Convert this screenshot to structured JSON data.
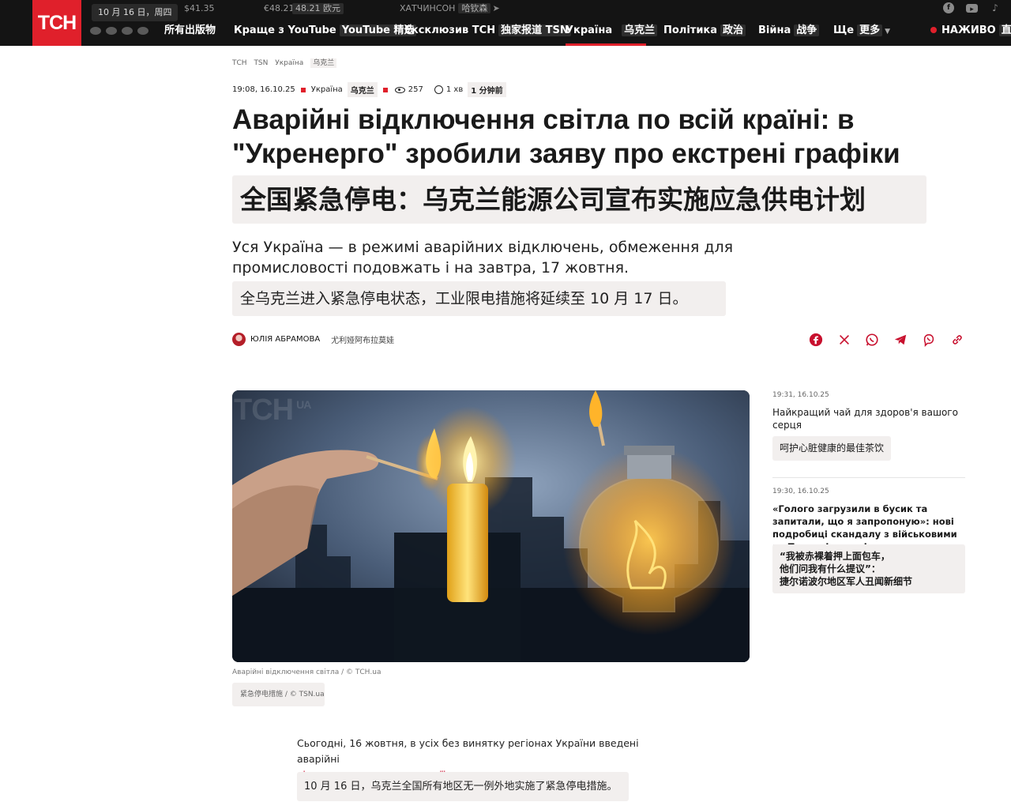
{
  "topbar": {
    "logo": "ТСН",
    "date": "10 月 16 日，周四",
    "rates": [
      "$41.35",
      "€48.21",
      "48.21 欧元"
    ],
    "weather_city": "ХАТЧИНСОН",
    "weather_city_zh": "哈钦森",
    "nav": [
      {
        "label": "所有出版物",
        "zh": ""
      },
      {
        "label": "Краще з YouTube",
        "zh": "YouTube 精选"
      },
      {
        "label": "Ексклюзив ТСН",
        "zh": "独家报道 TSN"
      },
      {
        "label": "Україна",
        "zh": "乌克兰"
      },
      {
        "label": "Політика",
        "zh": "政治"
      },
      {
        "label": "Війна",
        "zh": "战争"
      },
      {
        "label": "Ще",
        "zh": "更多"
      }
    ],
    "live": "НАЖИВО",
    "live_zh": "直播"
  },
  "breadcrumb": [
    "ТСН",
    "TSN",
    "Україна",
    "乌克兰"
  ],
  "meta": {
    "datetime": "19:08, 16.10.25",
    "category": "Україна",
    "category_zh": "乌克兰",
    "views": "257",
    "read_time": "1 хв",
    "read_time_zh": "1 分钟前"
  },
  "article": {
    "title": "Аварійні відключення світла по всій країні: в \"Укренерго\" зробили заяву про екстрені графіки",
    "title_zh": "全国紧急停电：乌克兰能源公司宣布实施应急供电计划",
    "lead": "Уся Україна — в режимі аварійних відключень, обмеження для промисловості подовжать і на завтра, 17 жовтня.",
    "lead_zh": "全乌克兰进入紧急停电状态，工业限电措施将延续至 10 月 17 日。",
    "author": "ЮЛІЯ АБРАМОВА",
    "author_zh": "尤利娅阿布拉莫娃",
    "image_watermark": "ТСН",
    "image_watermark_suffix": "UA",
    "caption": "Аварійні відключення світла / © ТСН.ua",
    "caption_zh": "紧急停电措施 / © TSN.ua",
    "body_text": "Сьогодні, 16 жовтня, в усіх без винятку регіонах України введені аварійні",
    "body_link": "відключення електроенергії.",
    "body_zh": "10 月 16 日，乌克兰全国所有地区无一例外地实施了紧急停电措施。"
  },
  "share_icons": [
    "facebook-icon",
    "x-icon",
    "whatsapp-icon",
    "telegram-icon",
    "viber-icon",
    "link-icon"
  ],
  "sidebar": [
    {
      "time": "19:31, 16.10.25",
      "title": "Найкращий чай для здоров'я вашого серця",
      "title_zh": "呵护心脏健康的最佳茶饮"
    },
    {
      "time": "19:30, 16.10.25",
      "title": "«Голого загрузили в бусик та запитали, що я запропоную»: нові подробиці скандалу з військовими на Тернопільщині",
      "title_zh_1": "“我被赤裸着押上面包车，",
      "title_zh_2": "他们问我有什么提议”：",
      "title_zh_3": "捷尔诺波尔地区军人丑闻新细节"
    }
  ],
  "colors": {
    "brand_red": "#e0202b",
    "link_red": "#c8102e",
    "topbar_bg": "#141414",
    "zh_highlight": "#f2efee"
  }
}
